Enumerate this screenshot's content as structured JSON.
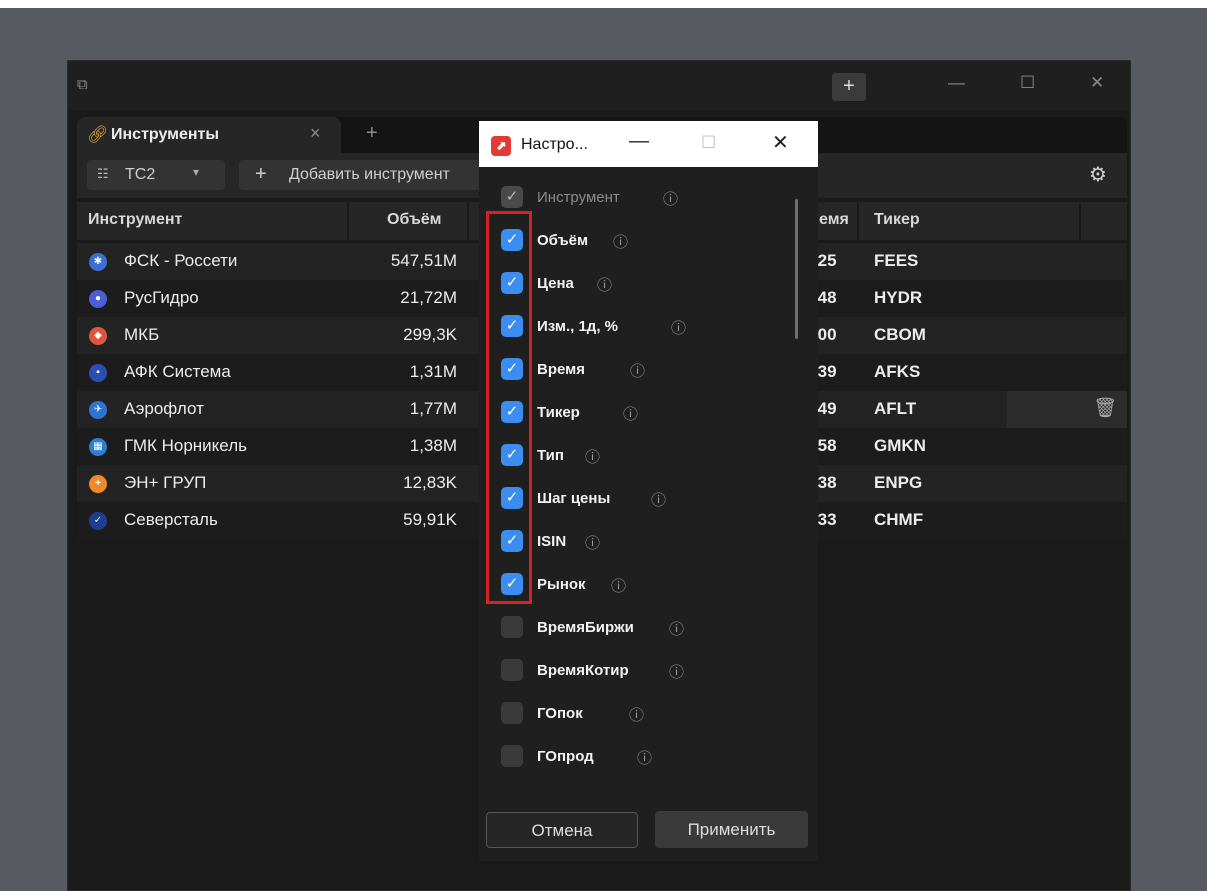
{
  "window": {
    "new_tab_label": "+"
  },
  "tab": {
    "title": "Инструменты",
    "close": "×",
    "add": "+"
  },
  "toolbar": {
    "tc_label": "ТС2",
    "add_label": "Добавить инструмент"
  },
  "table": {
    "headers": [
      "Инструмент",
      "Объём",
      "емя",
      "Тикер"
    ],
    "rows": [
      {
        "name": "ФСК - Россети",
        "volume": "547,51M",
        "time": ":25",
        "ticker": "FEES",
        "logo_color": "#3b6fd4",
        "logo_char": "✱"
      },
      {
        "name": "РусГидро",
        "volume": "21,72M",
        "time": ":48",
        "ticker": "HYDR",
        "logo_color": "#4a5fd6",
        "logo_char": "●"
      },
      {
        "name": "МКБ",
        "volume": "299,3K",
        "time": ":00",
        "ticker": "CBOM",
        "logo_color": "#e0553a",
        "logo_char": "◆"
      },
      {
        "name": "АФК Система",
        "volume": "1,31M",
        "time": ":39",
        "ticker": "AFKS",
        "logo_color": "#2a4fb0",
        "logo_char": "▪"
      },
      {
        "name": "Аэрофлот",
        "volume": "1,77M",
        "time": ":49",
        "ticker": "AFLT",
        "logo_color": "#2e74d4",
        "logo_char": "✈"
      },
      {
        "name": "ГМК Норникель",
        "volume": "1,38M",
        "time": ":58",
        "ticker": "GMKN",
        "logo_color": "#2f7fd0",
        "logo_char": "▦"
      },
      {
        "name": "ЭН+ ГРУП",
        "volume": "12,83K",
        "time": ":38",
        "ticker": "ENPG",
        "logo_color": "#f0892a",
        "logo_char": "+"
      },
      {
        "name": "Северсталь",
        "volume": "59,91K",
        "time": ":33",
        "ticker": "CHMF",
        "logo_color": "#1c3f8f",
        "logo_char": "✓"
      }
    ]
  },
  "dialog": {
    "title": "Настро...",
    "options": [
      {
        "label": "Инструмент",
        "state": "disabled"
      },
      {
        "label": "Объём",
        "state": "checked"
      },
      {
        "label": "Цена",
        "state": "checked"
      },
      {
        "label": "Изм., 1д, %",
        "state": "checked"
      },
      {
        "label": "Время",
        "state": "checked"
      },
      {
        "label": "Тикер",
        "state": "checked"
      },
      {
        "label": "Тип",
        "state": "checked"
      },
      {
        "label": "Шаг цены",
        "state": "checked"
      },
      {
        "label": "ISIN",
        "state": "checked"
      },
      {
        "label": "Рынок",
        "state": "checked"
      },
      {
        "label": "ВремяБиржи",
        "state": "unchecked"
      },
      {
        "label": "ВремяКотир",
        "state": "unchecked"
      },
      {
        "label": "ГОпок",
        "state": "unchecked"
      },
      {
        "label": "ГОпрод",
        "state": "unchecked"
      }
    ],
    "cancel_label": "Отмена",
    "apply_label": "Применить"
  },
  "colors": {
    "accent": "#3b8ef0",
    "highlight": "#d42323",
    "app_logo": "#e53935"
  }
}
